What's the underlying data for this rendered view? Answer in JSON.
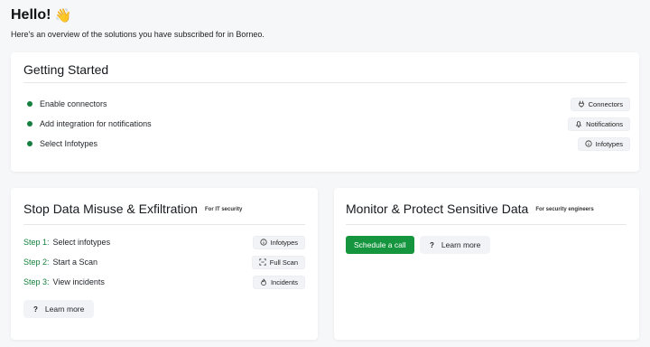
{
  "header": {
    "greeting": "Hello!",
    "wave_icon": "👋",
    "subtitle": "Here's an overview of the solutions you have subscribed for in Borneo."
  },
  "getting_started": {
    "title": "Getting Started",
    "items": [
      {
        "label": "Enable connectors",
        "action_label": "Connectors",
        "action_icon": "plug-icon"
      },
      {
        "label": "Add integration for notifications",
        "action_label": "Notifications",
        "action_icon": "bell-icon"
      },
      {
        "label": "Select Infotypes",
        "action_label": "Infotypes",
        "action_icon": "info-icon"
      }
    ],
    "bullet_color": "#15803d"
  },
  "misuse": {
    "title": "Stop Data Misuse & Exfiltration",
    "tag": "For IT security",
    "steps": [
      {
        "step": "Step 1:",
        "label": "Select infotypes",
        "action_label": "Infotypes",
        "action_icon": "info-icon"
      },
      {
        "step": "Step 2:",
        "label": "Start a Scan",
        "action_label": "Full Scan",
        "action_icon": "scan-icon"
      },
      {
        "step": "Step 3:",
        "label": "View incidents",
        "action_label": "Incidents",
        "action_icon": "flame-icon"
      }
    ],
    "learn_more": "Learn more",
    "help_glyph": "?"
  },
  "monitor": {
    "title": "Monitor & Protect Sensitive Data",
    "tag": "For security engineers",
    "primary_button": "Schedule a call",
    "learn_more": "Learn more",
    "help_glyph": "?"
  },
  "colors": {
    "accent_green": "#16953f",
    "step_green": "#15803d",
    "background": "#f6f7f9"
  }
}
